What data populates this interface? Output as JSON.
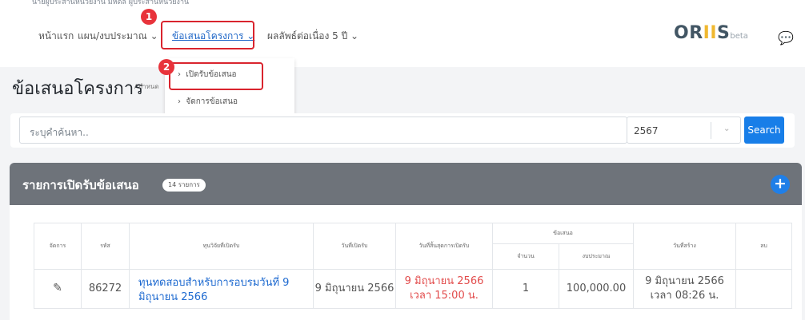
{
  "topbar": {
    "user_text": "นายผู้ประสานหน่วยงาน มหิดล ผู้ประสานหน่วยงาน"
  },
  "nav": {
    "home": "หน้าแรก",
    "plan": "แผน/งบประมาณ ⌄",
    "proposal": "ข้อเสนอโครงการ ⌄",
    "results": "ผลลัพธ์ต่อเนื่อง 5 ปี ⌄"
  },
  "annotations": {
    "step1": "1",
    "step2": "2",
    "accent": "#e8333b"
  },
  "logo": {
    "text_main": "OR",
    "text_ii": "II",
    "text_s": "S",
    "text_beta": "beta"
  },
  "chat_icon": "chat-icon",
  "page": {
    "title": "ข้อเสนอโครงการ",
    "breadcrumb": "/ กำหนด"
  },
  "dropdown": {
    "items": [
      "เปิดรับข้อเสนอ",
      "จัดการข้อเสนอ"
    ]
  },
  "search": {
    "placeholder": "ระบุคำค้นหา..",
    "year": "2567",
    "button": "Search",
    "button_color": "#187ee8"
  },
  "panel": {
    "title": "รายการเปิดรับข้อเสนอ",
    "badge": "14 รายการ"
  },
  "table": {
    "group_header": "ข้อเสนอ",
    "headers": [
      "จัดการ",
      "รหัส",
      "ทุนวิจัยที่เปิดรับ",
      "วันที่เปิดรับ",
      "วันที่สิ้นสุดการเปิดรับ",
      "จำนวน",
      "งบประมาณ",
      "วันที่สร้าง",
      "ลบ"
    ],
    "rows": [
      {
        "code": "86272",
        "fund": "ทุนทดสอบสำหรับการอบรมวันที่ 9 มิถุนายน 2566",
        "open": "9 มิถุนายน 2566",
        "close": "9 มิถุนายน 2566 เวลา 15:00 น.",
        "count": "1",
        "budget": "100,000.00",
        "created": "9 มิถุนายน 2566 เวลา 08:26 น."
      }
    ]
  }
}
